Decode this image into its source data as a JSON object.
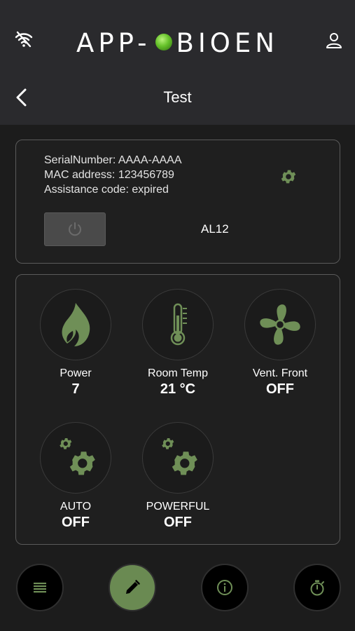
{
  "header": {
    "brand_left": "APP-",
    "brand_right": "BIOEN",
    "title": "Test"
  },
  "device": {
    "serial_line": "SerialNumber: AAAA-AAAA",
    "mac_line": "MAC address: 123456789",
    "assistance_line": "Assistance code: expired",
    "name": "AL12"
  },
  "tiles": [
    {
      "label": "Power",
      "value": "7",
      "icon": "flame-icon"
    },
    {
      "label": "Room Temp",
      "value": "21 °C",
      "icon": "thermometer-icon"
    },
    {
      "label": "Vent. Front",
      "value": "OFF",
      "icon": "fan-icon"
    },
    {
      "label": "AUTO",
      "value": "OFF",
      "icon": "gears-icon"
    },
    {
      "label": "POWERFUL",
      "value": "OFF",
      "icon": "gears-icon"
    }
  ],
  "bottom_nav": [
    {
      "icon": "list-icon"
    },
    {
      "icon": "pencil-icon",
      "active": true
    },
    {
      "icon": "info-icon"
    },
    {
      "icon": "stopwatch-icon"
    }
  ],
  "colors": {
    "accent_green": "#6a8a52",
    "icon_green": "#6f8f57",
    "header_bg": "#2a2a2d",
    "body_bg": "#1c1c1c"
  }
}
